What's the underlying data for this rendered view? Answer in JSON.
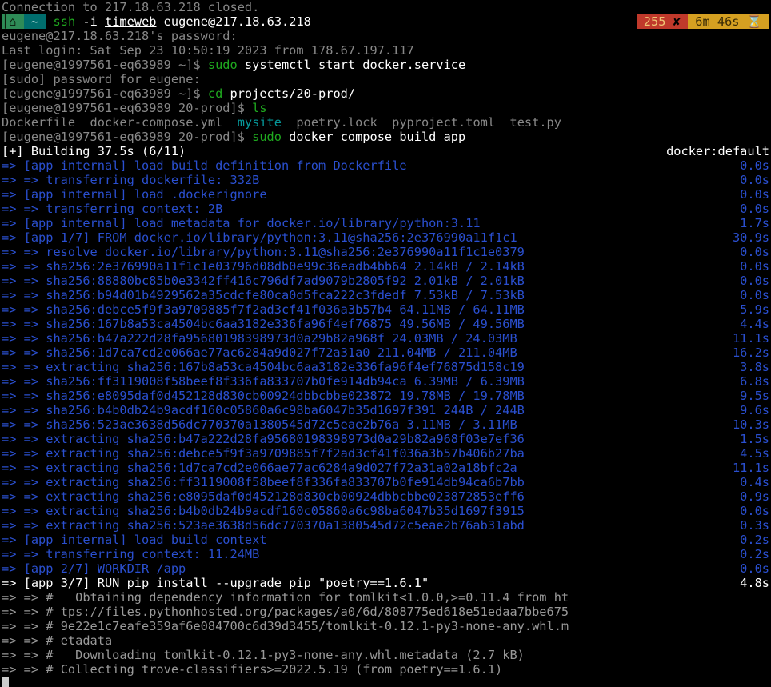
{
  "closed_line": "Connection to 217.18.63.218 closed.",
  "status": {
    "home": "⌂",
    "tilde": "~",
    "sep_r": "",
    "sep_l": "",
    "ssh_cmd": "ssh",
    "ssh_args": " -i ",
    "ssh_key": "timeweb",
    "ssh_host": " eugene@217.18.63.218",
    "err_code": " 255 ",
    "err_x": "✘ ",
    "timer": " 6m 46s ",
    "hourglass": "⌛"
  },
  "pw_prompt": "eugene@217.18.63.218's password:",
  "last_login": "Last login: Sat Sep 23 10:50:19 2023 from 178.67.197.117",
  "p1": {
    "prompt": "[eugene@1997561-eq63989 ~]$ ",
    "cmd": "sudo",
    "args": " systemctl start docker.service"
  },
  "sudo_pw": "[sudo] password for eugene:",
  "p2": {
    "prompt": "[eugene@1997561-eq63989 ~]$ ",
    "cmd": "cd",
    "args": " projects/20-prod/"
  },
  "p3": {
    "prompt": "[eugene@1997561-eq63989 20-prod]$ ",
    "cmd": "ls"
  },
  "ls": {
    "f1": "Dockerfile  ",
    "f2": "docker-compose.yml  ",
    "dir": "mysite",
    "f3": "  poetry.lock  ",
    "f4": "pyproject.toml  ",
    "f5": "test.py"
  },
  "p4": {
    "prompt": "[eugene@1997561-eq63989 20-prod]$ ",
    "cmd": "sudo",
    "args": " docker compose build app"
  },
  "build_header": {
    "left": "[+] Building 37.5s (6/11)",
    "right": "docker:default"
  },
  "build": [
    {
      "a": "=> ",
      "l": "[app internal] load build definition from Dockerfile",
      "t": "0.0s"
    },
    {
      "a": "=> => ",
      "l": "transferring dockerfile: 332B",
      "t": "0.0s"
    },
    {
      "a": "=> ",
      "l": "[app internal] load .dockerignore",
      "t": "0.0s"
    },
    {
      "a": "=> => ",
      "l": "transferring context: 2B",
      "t": "0.0s"
    },
    {
      "a": "=> ",
      "l": "[app internal] load metadata for docker.io/library/python:3.11",
      "t": "1.7s"
    },
    {
      "a": "=> ",
      "l": "[app 1/7] FROM docker.io/library/python:3.11@sha256:2e376990a11f1c1",
      "t": "30.9s"
    },
    {
      "a": "=> => ",
      "l": "resolve docker.io/library/python:3.11@sha256:2e376990a11f1c1e0379",
      "t": "0.0s"
    },
    {
      "a": "=> => ",
      "l": "sha256:2e376990a11f1c1e03796d08db0e99c36eadb4bb64 2.14kB / 2.14kB",
      "t": "0.0s"
    },
    {
      "a": "=> => ",
      "l": "sha256:88880bc85b0e3342ff416c796df7ad9079b2805f92 2.01kB / 2.01kB",
      "t": "0.0s"
    },
    {
      "a": "=> => ",
      "l": "sha256:b94d01b4929562a35cdcfe80ca0d5fca222c3fdedf 7.53kB / 7.53kB",
      "t": "0.0s"
    },
    {
      "a": "=> => ",
      "l": "sha256:debce5f9f3a9709885f7f2ad3cf41f036a3b57b4 64.11MB / 64.11MB",
      "t": "5.9s"
    },
    {
      "a": "=> => ",
      "l": "sha256:167b8a53ca4504bc6aa3182e336fa96f4ef76875 49.56MB / 49.56MB",
      "t": "4.4s"
    },
    {
      "a": "=> => ",
      "l": "sha256:b47a222d28fa95680198398973d0a29b82a968f 24.03MB / 24.03MB",
      "t": "11.1s"
    },
    {
      "a": "=> => ",
      "l": "sha256:1d7ca7cd2e066ae77ac6284a9d027f72a31a0 211.04MB / 211.04MB",
      "t": "16.2s"
    },
    {
      "a": "=> => ",
      "l": "extracting sha256:167b8a53ca4504bc6aa3182e336fa96f4ef76875d158c19",
      "t": "3.8s"
    },
    {
      "a": "=> => ",
      "l": "sha256:ff3119008f58beef8f336fa833707b0fe914db94ca 6.39MB / 6.39MB",
      "t": "6.8s"
    },
    {
      "a": "=> => ",
      "l": "sha256:e8095daf0d452128d830cb00924dbbcbbe023872 19.78MB / 19.78MB",
      "t": "9.5s"
    },
    {
      "a": "=> => ",
      "l": "sha256:b4b0db24b9acdf160c05860a6c98ba6047b35d1697f391 244B / 244B",
      "t": "9.6s"
    },
    {
      "a": "=> => ",
      "l": "sha256:523ae3638d56dc770370a1380545d72c5eae2b76a 3.11MB / 3.11MB",
      "t": "10.3s"
    },
    {
      "a": "=> => ",
      "l": "extracting sha256:b47a222d28fa95680198398973d0a29b82a968f03e7ef36",
      "t": "1.5s"
    },
    {
      "a": "=> => ",
      "l": "extracting sha256:debce5f9f3a9709885f7f2ad3cf41f036a3b57b406b27ba",
      "t": "4.5s"
    },
    {
      "a": "=> => ",
      "l": "extracting sha256:1d7ca7cd2e066ae77ac6284a9d027f72a31a02a18bfc2a",
      "t": "11.1s"
    },
    {
      "a": "=> => ",
      "l": "extracting sha256:ff3119008f58beef8f336fa833707b0fe914db94ca6b7bb",
      "t": "0.4s"
    },
    {
      "a": "=> => ",
      "l": "extracting sha256:e8095daf0d452128d830cb00924dbbcbbe023872853eff6",
      "t": "0.9s"
    },
    {
      "a": "=> => ",
      "l": "extracting sha256:b4b0db24b9acdf160c05860a6c98ba6047b35d1697f3915",
      "t": "0.0s"
    },
    {
      "a": "=> => ",
      "l": "extracting sha256:523ae3638d56dc770370a1380545d72c5eae2b76ab31abd",
      "t": "0.3s"
    },
    {
      "a": "=> ",
      "l": "[app internal] load build context",
      "t": "0.2s"
    },
    {
      "a": "=> => ",
      "l": "transferring context: 11.24MB",
      "t": "0.2s"
    },
    {
      "a": "=> ",
      "l": "[app 2/7] WORKDIR /app",
      "t": "0.0s"
    }
  ],
  "active": {
    "a": "=> ",
    "l": "[app 3/7] RUN pip install --upgrade pip \"poetry==1.6.1\"",
    "t": "4.8s"
  },
  "tail": [
    {
      "a": "=> => # ",
      "l": "  Obtaining dependency information for tomlkit<1.0.0,>=0.11.4 from ht"
    },
    {
      "a": "=> => # ",
      "l": "tps://files.pythonhosted.org/packages/a0/6d/808775ed618e51edaa7bbe675"
    },
    {
      "a": "=> => # ",
      "l": "9e22e1c7eafe359af6e084700c6d39d3455/tomlkit-0.12.1-py3-none-any.whl.m"
    },
    {
      "a": "=> => # ",
      "l": "etadata"
    },
    {
      "a": "=> => # ",
      "l": "  Downloading tomlkit-0.12.1-py3-none-any.whl.metadata (2.7 kB)"
    },
    {
      "a": "=> => # ",
      "l": "Collecting trove-classifiers>=2022.5.19 (from poetry==1.6.1)"
    }
  ]
}
